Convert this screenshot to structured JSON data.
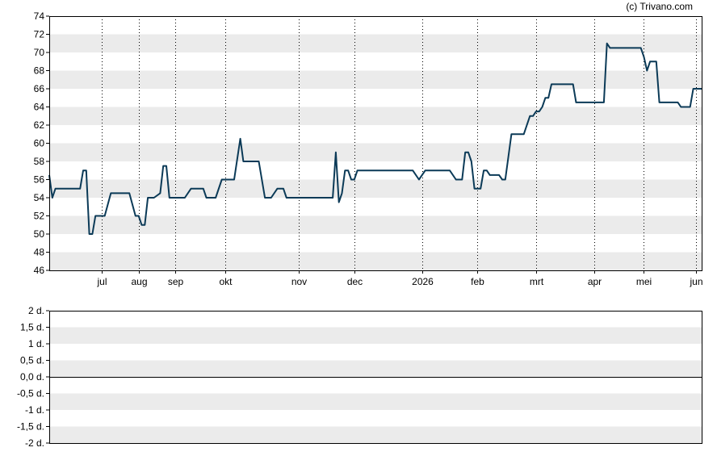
{
  "credit": "(c) Trivano.com",
  "colors": {
    "line": "#0b3a57",
    "band": "#ebebeb",
    "frame": "#000000",
    "vgrid": "#000000"
  },
  "chart_data": [
    {
      "type": "line",
      "title": "",
      "xlabel": "",
      "ylabel": "",
      "ylim": [
        46,
        74
      ],
      "yticks": [
        "46",
        "48",
        "50",
        "52",
        "54",
        "56",
        "58",
        "60",
        "62",
        "64",
        "66",
        "68",
        "70",
        "72",
        "74"
      ],
      "grid": "alternating horizontal bands, dotted vertical lines at month starts",
      "x_ticks": [
        {
          "label": "jul",
          "t": 8.5
        },
        {
          "label": "aug",
          "t": 14.5
        },
        {
          "label": "sep",
          "t": 20.5
        },
        {
          "label": "okt",
          "t": 28.5
        },
        {
          "label": "nov",
          "t": 40.5
        },
        {
          "label": "dec",
          "t": 49.5
        },
        {
          "label": "2026",
          "t": 60.5
        },
        {
          "label": "feb",
          "t": 69.5
        },
        {
          "label": "mrt",
          "t": 79.0
        },
        {
          "label": "apr",
          "t": 88.5
        },
        {
          "label": "mei",
          "t": 96.5
        },
        {
          "label": "jun",
          "t": 105.0
        }
      ],
      "x_range": [
        0,
        106
      ],
      "series": [
        {
          "points": [
            [
              0,
              56.5
            ],
            [
              0.5,
              54
            ],
            [
              1,
              55
            ],
            [
              2,
              55
            ],
            [
              3,
              55
            ],
            [
              4,
              55
            ],
            [
              5,
              55
            ],
            [
              5.5,
              57
            ],
            [
              6,
              57
            ],
            [
              6.5,
              50
            ],
            [
              7,
              50
            ],
            [
              7.5,
              52
            ],
            [
              8,
              52
            ],
            [
              9,
              52
            ],
            [
              10,
              54.5
            ],
            [
              11,
              54.5
            ],
            [
              12,
              54.5
            ],
            [
              13,
              54.5
            ],
            [
              14,
              52
            ],
            [
              14.5,
              52
            ],
            [
              15,
              51
            ],
            [
              15.5,
              51
            ],
            [
              16,
              54
            ],
            [
              17,
              54
            ],
            [
              18,
              54.5
            ],
            [
              18.5,
              57.5
            ],
            [
              19,
              57.5
            ],
            [
              19.5,
              54
            ],
            [
              20,
              54
            ],
            [
              21,
              54
            ],
            [
              22,
              54
            ],
            [
              23,
              55
            ],
            [
              24,
              55
            ],
            [
              25,
              55
            ],
            [
              25.5,
              54
            ],
            [
              26,
              54
            ],
            [
              27,
              54
            ],
            [
              28,
              56
            ],
            [
              29,
              56
            ],
            [
              30,
              56
            ],
            [
              31,
              60.5
            ],
            [
              31.5,
              58
            ],
            [
              32,
              58
            ],
            [
              33,
              58
            ],
            [
              34,
              58
            ],
            [
              35,
              54
            ],
            [
              36,
              54
            ],
            [
              37,
              55
            ],
            [
              38,
              55
            ],
            [
              38.5,
              54
            ],
            [
              39,
              54
            ],
            [
              40,
              54
            ],
            [
              41,
              54
            ],
            [
              42,
              54
            ],
            [
              43,
              54
            ],
            [
              44,
              54
            ],
            [
              45,
              54
            ],
            [
              46,
              54
            ],
            [
              46.5,
              59
            ],
            [
              47,
              53.5
            ],
            [
              47.5,
              54.5
            ],
            [
              48,
              57
            ],
            [
              48.5,
              57
            ],
            [
              49,
              56
            ],
            [
              49.5,
              56
            ],
            [
              50,
              57
            ],
            [
              51,
              57
            ],
            [
              52,
              57
            ],
            [
              53,
              57
            ],
            [
              54,
              57
            ],
            [
              55,
              57
            ],
            [
              56,
              57
            ],
            [
              57,
              57
            ],
            [
              58,
              57
            ],
            [
              59,
              57
            ],
            [
              60,
              56
            ],
            [
              61,
              57
            ],
            [
              62,
              57
            ],
            [
              63,
              57
            ],
            [
              64,
              57
            ],
            [
              65,
              57
            ],
            [
              66,
              56
            ],
            [
              67,
              56
            ],
            [
              67.5,
              59
            ],
            [
              68,
              59
            ],
            [
              68.5,
              58
            ],
            [
              69,
              55
            ],
            [
              70,
              55
            ],
            [
              70.5,
              57
            ],
            [
              71,
              57
            ],
            [
              71.5,
              56.5
            ],
            [
              72,
              56.5
            ],
            [
              73,
              56.5
            ],
            [
              73.5,
              56
            ],
            [
              74,
              56
            ],
            [
              75,
              61
            ],
            [
              76,
              61
            ],
            [
              77,
              61
            ],
            [
              78,
              63
            ],
            [
              78.5,
              63
            ],
            [
              79,
              63.5
            ],
            [
              79.5,
              63.5
            ],
            [
              80,
              64
            ],
            [
              80.5,
              65
            ],
            [
              81,
              65
            ],
            [
              81.5,
              66.5
            ],
            [
              82,
              66.5
            ],
            [
              83,
              66.5
            ],
            [
              84,
              66.5
            ],
            [
              85,
              66.5
            ],
            [
              85.5,
              64.5
            ],
            [
              86,
              64.5
            ],
            [
              87,
              64.5
            ],
            [
              88,
              64.5
            ],
            [
              89,
              64.5
            ],
            [
              90,
              64.5
            ],
            [
              90.5,
              71
            ],
            [
              91,
              70.5
            ],
            [
              92,
              70.5
            ],
            [
              93,
              70.5
            ],
            [
              94,
              70.5
            ],
            [
              95,
              70.5
            ],
            [
              96,
              70.5
            ],
            [
              96.5,
              69.5
            ],
            [
              97,
              68
            ],
            [
              97.5,
              69
            ],
            [
              98,
              69
            ],
            [
              98.5,
              69
            ],
            [
              99,
              64.5
            ],
            [
              100,
              64.5
            ],
            [
              101,
              64.5
            ],
            [
              102,
              64.5
            ],
            [
              102.5,
              64
            ],
            [
              103,
              64
            ],
            [
              104,
              64
            ],
            [
              104.5,
              66
            ],
            [
              105,
              66
            ],
            [
              106,
              66
            ]
          ]
        }
      ]
    },
    {
      "type": "line",
      "title": "",
      "xlabel": "",
      "ylabel": "",
      "ylim": [
        -2,
        2
      ],
      "yticks": [
        "-2 d.",
        "-1,5 d.",
        "-1 d.",
        "-0,5 d.",
        "0,0 d.",
        "0,5 d.",
        "1 d.",
        "1,5 d.",
        "2 d."
      ],
      "grid": "alternating horizontal bands",
      "baseline": 0,
      "series": []
    }
  ]
}
